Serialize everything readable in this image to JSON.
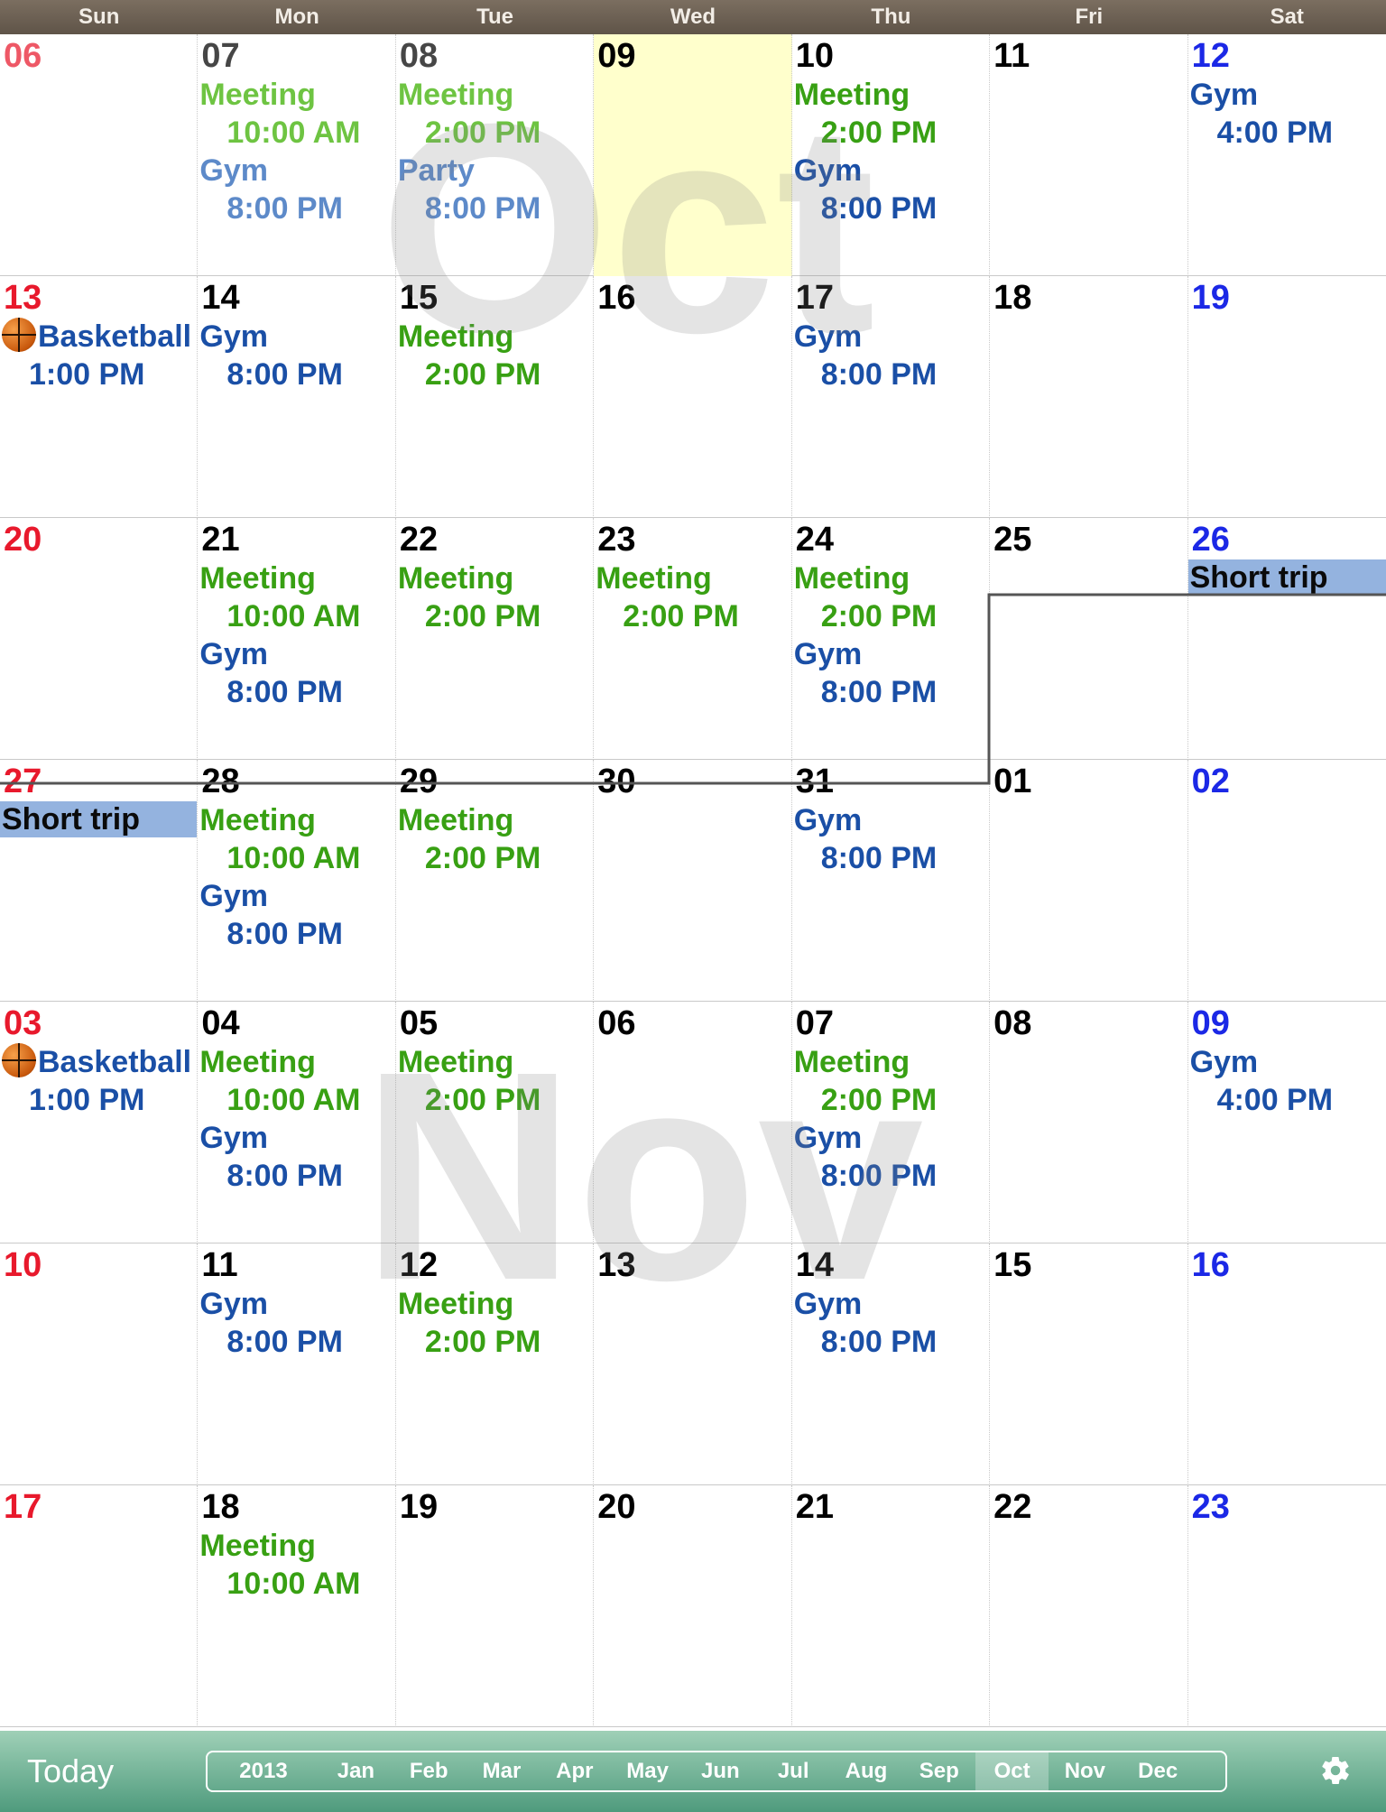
{
  "weekdays": [
    "Sun",
    "Mon",
    "Tue",
    "Wed",
    "Thu",
    "Fri",
    "Sat"
  ],
  "watermarks": {
    "oct": "Oct",
    "nov": "Nov"
  },
  "weeks": [
    [
      {
        "day": "06",
        "col": "sun",
        "dim": true,
        "events": []
      },
      {
        "day": "07",
        "dim": true,
        "events": [
          {
            "title": "Meeting",
            "time": "10:00 AM",
            "color": "green"
          },
          {
            "title": "Gym",
            "time": "8:00 PM",
            "color": "blue"
          }
        ]
      },
      {
        "day": "08",
        "dim": true,
        "events": [
          {
            "title": "Meeting",
            "time": "2:00 PM",
            "color": "green"
          },
          {
            "title": "Party",
            "time": "8:00 PM",
            "color": "blue"
          }
        ]
      },
      {
        "day": "09",
        "today": true,
        "events": []
      },
      {
        "day": "10",
        "events": [
          {
            "title": "Meeting",
            "time": "2:00 PM",
            "color": "green"
          },
          {
            "title": "Gym",
            "time": "8:00 PM",
            "color": "blue"
          }
        ]
      },
      {
        "day": "11",
        "events": []
      },
      {
        "day": "12",
        "col": "sat",
        "events": [
          {
            "title": "Gym",
            "time": "4:00 PM",
            "color": "blue"
          }
        ]
      }
    ],
    [
      {
        "day": "13",
        "col": "sun",
        "events": [
          {
            "title": "Basketball",
            "time": "1:00 PM",
            "color": "blue",
            "icon": "basketball"
          }
        ]
      },
      {
        "day": "14",
        "events": [
          {
            "title": "Gym",
            "time": "8:00 PM",
            "color": "blue"
          }
        ]
      },
      {
        "day": "15",
        "events": [
          {
            "title": "Meeting",
            "time": "2:00 PM",
            "color": "green"
          }
        ]
      },
      {
        "day": "16",
        "events": []
      },
      {
        "day": "17",
        "events": [
          {
            "title": "Gym",
            "time": "8:00 PM",
            "color": "blue"
          }
        ]
      },
      {
        "day": "18",
        "events": []
      },
      {
        "day": "19",
        "col": "sat",
        "events": []
      }
    ],
    [
      {
        "day": "20",
        "col": "sun",
        "events": []
      },
      {
        "day": "21",
        "events": [
          {
            "title": "Meeting",
            "time": "10:00 AM",
            "color": "green"
          },
          {
            "title": "Gym",
            "time": "8:00 PM",
            "color": "blue"
          }
        ]
      },
      {
        "day": "22",
        "events": [
          {
            "title": "Meeting",
            "time": "2:00 PM",
            "color": "green"
          }
        ]
      },
      {
        "day": "23",
        "events": [
          {
            "title": "Meeting",
            "time": "2:00 PM",
            "color": "green"
          }
        ]
      },
      {
        "day": "24",
        "events": [
          {
            "title": "Meeting",
            "time": "2:00 PM",
            "color": "green"
          },
          {
            "title": "Gym",
            "time": "8:00 PM",
            "color": "blue"
          }
        ]
      },
      {
        "day": "25",
        "events": []
      },
      {
        "day": "26",
        "col": "sat",
        "allday": "Short trip",
        "events": []
      }
    ],
    [
      {
        "day": "27",
        "col": "sun",
        "allday": "Short trip",
        "events": []
      },
      {
        "day": "28",
        "events": [
          {
            "title": "Meeting",
            "time": "10:00 AM",
            "color": "green"
          },
          {
            "title": "Gym",
            "time": "8:00 PM",
            "color": "blue"
          }
        ]
      },
      {
        "day": "29",
        "events": [
          {
            "title": "Meeting",
            "time": "2:00 PM",
            "color": "green"
          }
        ]
      },
      {
        "day": "30",
        "events": []
      },
      {
        "day": "31",
        "events": [
          {
            "title": "Gym",
            "time": "8:00 PM",
            "color": "blue"
          }
        ]
      },
      {
        "day": "01",
        "events": []
      },
      {
        "day": "02",
        "col": "sat",
        "events": []
      }
    ],
    [
      {
        "day": "03",
        "col": "sun",
        "events": [
          {
            "title": "Basketball",
            "time": "1:00 PM",
            "color": "blue",
            "icon": "basketball"
          }
        ]
      },
      {
        "day": "04",
        "events": [
          {
            "title": "Meeting",
            "time": "10:00 AM",
            "color": "green"
          },
          {
            "title": "Gym",
            "time": "8:00 PM",
            "color": "blue"
          }
        ]
      },
      {
        "day": "05",
        "events": [
          {
            "title": "Meeting",
            "time": "2:00 PM",
            "color": "green"
          }
        ]
      },
      {
        "day": "06",
        "events": []
      },
      {
        "day": "07",
        "events": [
          {
            "title": "Meeting",
            "time": "2:00 PM",
            "color": "green"
          },
          {
            "title": "Gym",
            "time": "8:00 PM",
            "color": "blue"
          }
        ]
      },
      {
        "day": "08",
        "events": []
      },
      {
        "day": "09",
        "col": "sat",
        "events": [
          {
            "title": "Gym",
            "time": "4:00 PM",
            "color": "blue"
          }
        ]
      }
    ],
    [
      {
        "day": "10",
        "col": "sun",
        "events": []
      },
      {
        "day": "11",
        "events": [
          {
            "title": "Gym",
            "time": "8:00 PM",
            "color": "blue"
          }
        ]
      },
      {
        "day": "12",
        "events": [
          {
            "title": "Meeting",
            "time": "2:00 PM",
            "color": "green"
          }
        ]
      },
      {
        "day": "13",
        "events": []
      },
      {
        "day": "14",
        "events": [
          {
            "title": "Gym",
            "time": "8:00 PM",
            "color": "blue"
          }
        ]
      },
      {
        "day": "15",
        "events": []
      },
      {
        "day": "16",
        "col": "sat",
        "events": []
      }
    ],
    [
      {
        "day": "17",
        "col": "sun",
        "events": []
      },
      {
        "day": "18",
        "events": [
          {
            "title": "Meeting",
            "time": "10:00 AM",
            "color": "green"
          }
        ]
      },
      {
        "day": "19",
        "events": []
      },
      {
        "day": "20",
        "events": []
      },
      {
        "day": "21",
        "events": []
      },
      {
        "day": "22",
        "events": []
      },
      {
        "day": "23",
        "col": "sat",
        "events": []
      }
    ]
  ],
  "colors": {
    "green": "#38a013",
    "blue": "#1a4fa6",
    "sunday": "#e8192c",
    "saturday": "#1b28e6",
    "today_bg": "#ffffcc",
    "allday_bg": "#94b3df"
  },
  "bottom_bar": {
    "today_label": "Today",
    "year": "2013",
    "months": [
      "Jan",
      "Feb",
      "Mar",
      "Apr",
      "May",
      "Jun",
      "Jul",
      "Aug",
      "Sep",
      "Oct",
      "Nov",
      "Dec"
    ],
    "selected_month": "Oct",
    "settings_icon": "gear-icon"
  }
}
